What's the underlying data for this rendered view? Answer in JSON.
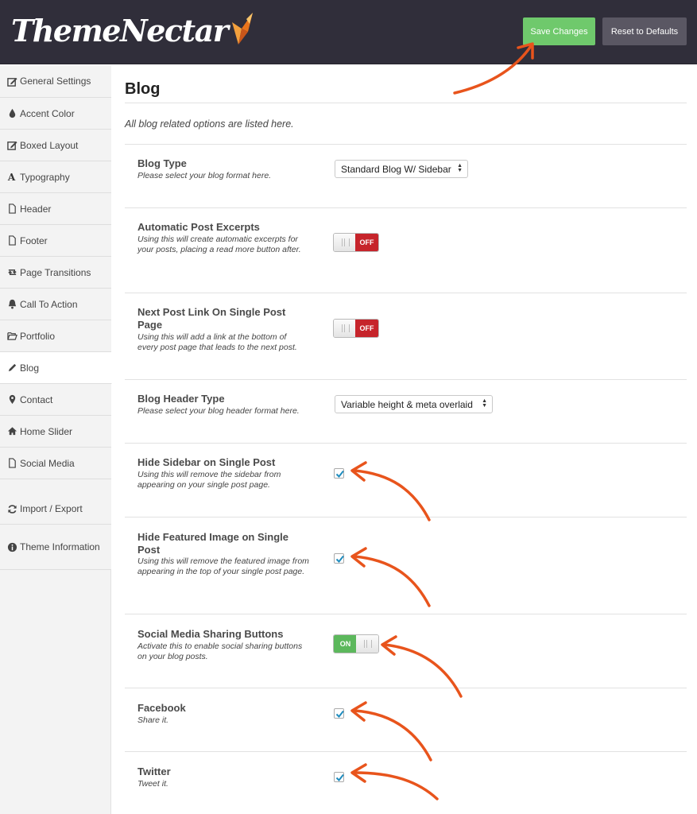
{
  "header": {
    "logo_text": "ThemeNectar",
    "save_label": "Save Changes",
    "reset_label": "Reset to Defaults"
  },
  "sidebar": {
    "items": [
      {
        "label": "General Settings",
        "icon": "edit-icon"
      },
      {
        "label": "Accent Color",
        "icon": "drop-icon"
      },
      {
        "label": "Boxed Layout",
        "icon": "edit-icon"
      },
      {
        "label": "Typography",
        "icon": "font-icon"
      },
      {
        "label": "Header",
        "icon": "file-icon"
      },
      {
        "label": "Footer",
        "icon": "file-icon"
      },
      {
        "label": "Page Transitions",
        "icon": "retweet-icon"
      },
      {
        "label": "Call To Action",
        "icon": "bell-icon"
      },
      {
        "label": "Portfolio",
        "icon": "folder-open-icon"
      },
      {
        "label": "Blog",
        "icon": "pencil-icon",
        "active": true
      },
      {
        "label": "Contact",
        "icon": "map-marker-icon"
      },
      {
        "label": "Home Slider",
        "icon": "home-icon"
      },
      {
        "label": "Social Media",
        "icon": "file-icon"
      },
      {
        "label": "Import / Export",
        "icon": "refresh-icon"
      },
      {
        "label": "Theme Information",
        "icon": "info-icon"
      }
    ]
  },
  "main": {
    "title": "Blog",
    "description": "All blog related options are listed here.",
    "options": [
      {
        "title": "Blog Type",
        "desc": "Please select your blog format here.",
        "control": "select",
        "value": "Standard Blog W/ Sidebar"
      },
      {
        "title": "Automatic Post Excerpts",
        "desc": "Using this will create automatic excerpts for your posts, placing a read more button after.",
        "control": "switch",
        "state": "OFF"
      },
      {
        "title": "Next Post Link On Single Post Page",
        "desc": "Using this will add a link at the bottom of every post page that leads to the next post.",
        "control": "switch",
        "state": "OFF"
      },
      {
        "title": "Blog Header Type",
        "desc": "Please select your blog header format here.",
        "control": "select",
        "value": "Variable height & meta overlaid"
      },
      {
        "title": "Hide Sidebar on Single Post",
        "desc": "Using this will remove the sidebar from appearing on your single post page.",
        "control": "checkbox",
        "checked": true
      },
      {
        "title": "Hide Featured Image on Single Post",
        "desc": "Using this will remove the featured image from appearing in the top of your single post page.",
        "control": "checkbox",
        "checked": true
      },
      {
        "title": "Social Media Sharing Buttons",
        "desc": "Activate this to enable social sharing buttons on your blog posts.",
        "control": "switch",
        "state": "ON"
      },
      {
        "title": "Facebook",
        "desc": "Share it.",
        "control": "checkbox",
        "checked": true
      },
      {
        "title": "Twitter",
        "desc": "Tweet it.",
        "control": "checkbox",
        "checked": true
      }
    ]
  },
  "colors": {
    "header_bg": "#302e3a",
    "save_green": "#6fc96c",
    "reset_gray": "#5a5763",
    "switch_off_red": "#c6242b",
    "switch_on_green": "#5cb85c",
    "annotation_orange": "#e8541c"
  }
}
